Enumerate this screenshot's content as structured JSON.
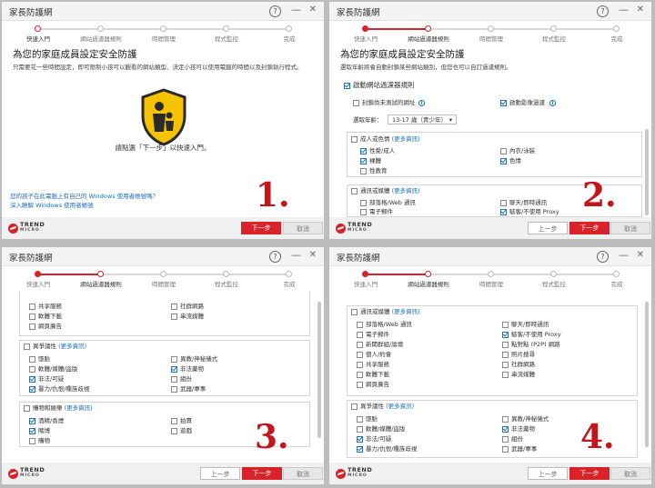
{
  "app_title": "家長防護網",
  "steps": [
    "快速入門",
    "網站過濾器規則",
    "時間管理",
    "程式監控",
    "完成"
  ],
  "buttons": {
    "prev": "上一步",
    "next": "下一步",
    "cancel": "取消"
  },
  "logo": {
    "line1": "TREND",
    "line2": "MICRO"
  },
  "panel1": {
    "heading": "為您的家庭成員設定安全防護",
    "desc": "只需要花一些時間設定，即可限制小孩可以觀看的網站類型、決定小孩可以使用電腦的時間以及封鎖執行程式。",
    "center_msg": "請點選「下一步」以快速入門。",
    "link1": "您的孩子在此電腦上有自己的 Windows 使用者帳號嗎？",
    "link2": "深入瞭解 Windows 使用者帳號",
    "number": "1."
  },
  "panel2": {
    "heading": "為您的家庭成員設定安全防護",
    "desc": "選取年齡將會自動封鎖某些網站類別，但您也可以自訂過濾規則。",
    "enable_filter": "啟動網站過濾器規則",
    "block_unrated": "封鎖尚未測試的網址",
    "enable_video": "啟動影像過濾",
    "age_label": "選取年齡：",
    "age_value": "13-17 歲（青少年）",
    "cat_adult": "成人或色情",
    "more": "(更多資訊)",
    "adult_items": [
      "性愛/成人",
      "內衣/泳裝",
      "裸體",
      "色情",
      "性教育"
    ],
    "cat_comm": "通訊或媒體",
    "comm_items": [
      "部落格/Web 通訊",
      "聊天/即時通訊",
      "電子郵件",
      "駭客/不使用 Proxy"
    ],
    "number": "2."
  },
  "panel3": {
    "top_items": [
      "共享服務",
      "社群網路",
      "軟體下載",
      "串流媒體",
      "網頁廣告"
    ],
    "cat_social": "異爭議性",
    "social_items": [
      "墮胎",
      "異教/神秘儀式",
      "軟體/媒體/盜版",
      "非法藥物",
      "非法/可疑",
      "組份",
      "暴力/仇恨/種族歧視",
      "武器/軍事"
    ],
    "cat_shop": "購物和娛樂",
    "shop_items": [
      "酒精/香煙",
      "拍賣",
      "賭博",
      "遊戲",
      "購物"
    ],
    "number": "3."
  },
  "panel4": {
    "cat_comm": "通訊或媒體",
    "comm_items": [
      "部落格/Web 通訊",
      "聊天/即時通訊",
      "電子郵件",
      "駭客/不使用 Proxy",
      "新聞群組/論壇",
      "點對點 (P2P) 網路",
      "個人/約會",
      "照片搜尋",
      "共享服務",
      "社群網路",
      "軟體下載",
      "串流媒體",
      "網頁廣告"
    ],
    "cat_social": "異爭議性",
    "social_items": [
      "墮胎",
      "異教/神秘儀式",
      "軟體/媒體/盜版",
      "非法藥物",
      "非法/可疑",
      "組份",
      "暴力/仇恨/種族歧視",
      "武器/軍事"
    ],
    "number": "4."
  },
  "colors": {
    "accent": "#d8232a",
    "link": "#1a6fc4",
    "check": "#2e6fb8"
  }
}
